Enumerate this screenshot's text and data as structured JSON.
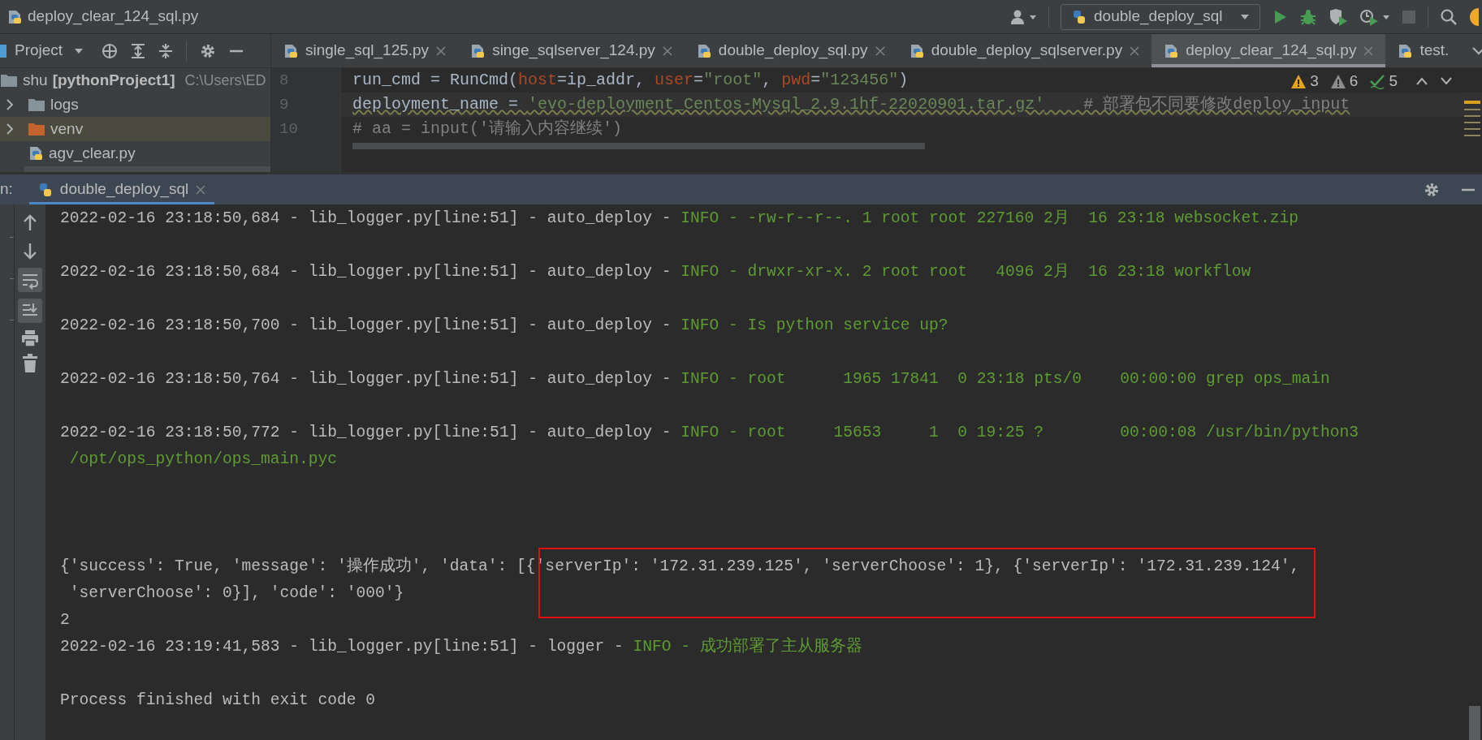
{
  "window": {
    "title": "deploy_clear_124_sql.py"
  },
  "toolbar": {
    "run_config": "double_deploy_sql",
    "stop_button": {
      "disabled": true
    }
  },
  "project_panel": {
    "title": "Project",
    "tree": [
      {
        "label": "shu",
        "detail": "[pythonProject1]",
        "path": "C:\\Users\\ED",
        "kind": "folder",
        "selected": false,
        "children": [
          {
            "label": "logs",
            "kind": "folder",
            "expanded": false,
            "selected": false
          },
          {
            "label": "venv",
            "kind": "excluded_folder",
            "expanded": false,
            "selected": true
          },
          {
            "label": "agv_clear.py",
            "kind": "python_file",
            "selected": false
          }
        ]
      }
    ]
  },
  "editor_tabs": [
    {
      "label": "single_sql_125.py",
      "selected": false,
      "closable": true
    },
    {
      "label": "singe_sqlserver_124.py",
      "selected": false,
      "closable": true
    },
    {
      "label": "double_deploy_sql.py",
      "selected": false,
      "closable": true
    },
    {
      "label": "double_deploy_sqlserver.py",
      "selected": false,
      "closable": true
    },
    {
      "label": "deploy_clear_124_sql.py",
      "selected": true,
      "closable": true
    },
    {
      "label": "test.",
      "selected": false,
      "closable": false
    }
  ],
  "editor": {
    "inspections": {
      "warnings": "3",
      "weak_warnings": "6",
      "typos": "5"
    },
    "lines": [
      {
        "number": "8",
        "current": false,
        "segments": [
          {
            "kind": "plain",
            "text": "run_cmd = RunCmd("
          },
          {
            "kind": "param",
            "text": "host"
          },
          {
            "kind": "plain",
            "text": "=ip_addr, "
          },
          {
            "kind": "param",
            "text": "user"
          },
          {
            "kind": "plain",
            "text": "="
          },
          {
            "kind": "string",
            "text": "\"root\""
          },
          {
            "kind": "plain",
            "text": ", "
          },
          {
            "kind": "param",
            "text": "pwd"
          },
          {
            "kind": "plain",
            "text": "="
          },
          {
            "kind": "string",
            "text": "\"123456\""
          },
          {
            "kind": "plain",
            "text": ")"
          }
        ]
      },
      {
        "number": "9",
        "current": true,
        "segments": [
          {
            "kind": "plain",
            "text": "deployment_name = "
          },
          {
            "kind": "string",
            "text": "'evo-deployment_Centos-Mysql_2.9.1hf-22020901.tar.gz'"
          },
          {
            "kind": "comment",
            "text": "    # 部署包不同要修改deploy_input"
          }
        ]
      },
      {
        "number": "10",
        "current": false,
        "segments": [
          {
            "kind": "comment",
            "text": "# aa = input('请输入内容继续')"
          }
        ]
      }
    ]
  },
  "run_panel": {
    "title": "n:",
    "tabs": [
      {
        "label": "double_deploy_sql",
        "selected": true
      }
    ],
    "output": [
      {
        "kind": "log",
        "lines": [
          [
            {
              "kind": "plain",
              "text": "2022-02-16 23:18:50,684 - lib_logger.py[line:51] - auto_deploy - "
            },
            {
              "kind": "info",
              "text": "INFO - -rw-r--r--. 1 root root 227160 2月  16 23:18 websocket.zip"
            }
          ]
        ]
      },
      {
        "kind": "log",
        "lines": [
          [
            {
              "kind": "plain",
              "text": "2022-02-16 23:18:50,684 - lib_logger.py[line:51] - auto_deploy - "
            },
            {
              "kind": "info",
              "text": "INFO - drwxr-xr-x. 2 root root   4096 2月  16 23:18 workflow"
            }
          ]
        ]
      },
      {
        "kind": "log",
        "lines": [
          [
            {
              "kind": "plain",
              "text": "2022-02-16 23:18:50,700 - lib_logger.py[line:51] - auto_deploy - "
            },
            {
              "kind": "info",
              "text": "INFO - Is python service up?"
            }
          ]
        ]
      },
      {
        "kind": "log",
        "lines": [
          [
            {
              "kind": "plain",
              "text": "2022-02-16 23:18:50,764 - lib_logger.py[line:51] - auto_deploy - "
            },
            {
              "kind": "info",
              "text": "INFO - root      1965 17841  0 23:18 pts/0    00:00:00 grep ops_main"
            }
          ]
        ]
      },
      {
        "kind": "log",
        "lines": [
          [
            {
              "kind": "plain",
              "text": "2022-02-16 23:18:50,772 - lib_logger.py[line:51] - auto_deploy - "
            },
            {
              "kind": "info",
              "text": "INFO - root     15653     1  0 19:25 ?        00:00:08 /usr/bin/python3"
            }
          ],
          [
            {
              "kind": "info",
              "text": " /opt/ops_python/ops_main.pyc"
            }
          ]
        ]
      },
      {
        "kind": "result",
        "lines": [
          [
            {
              "kind": "plain",
              "text": "{'success': True, 'message': '操作成功', 'data': [{"
            },
            {
              "kind": "plain",
              "text": "'serverIp': '172.31.239.125', 'serverChoose': 1}, {'serverIp': '172.31.239.124',",
              "annotated": true
            }
          ],
          [
            {
              "kind": "plain",
              "text": " 'serverChoose': 0}], 'code': '000'}"
            }
          ],
          [
            {
              "kind": "plain",
              "text": "2"
            }
          ],
          [
            {
              "kind": "plain",
              "text": "2022-02-16 23:19:41,583 - lib_logger.py[line:51] - logger - "
            },
            {
              "kind": "info",
              "text": "INFO - 成功部署了主从服务器"
            }
          ]
        ]
      },
      {
        "kind": "log",
        "lines": [
          [
            {
              "kind": "plain",
              "text": "Process finished with exit code 0"
            }
          ]
        ]
      }
    ]
  }
}
